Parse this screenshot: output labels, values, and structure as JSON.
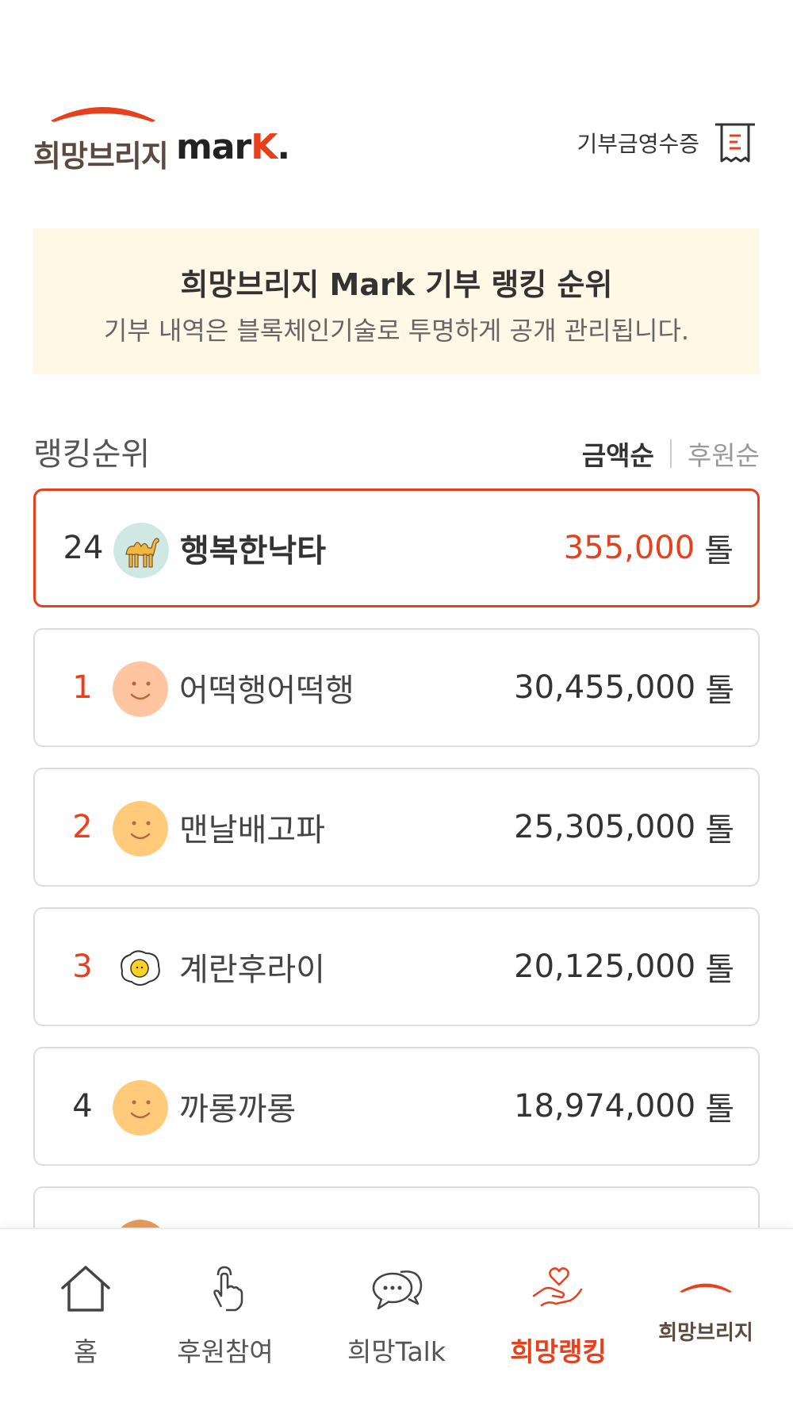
{
  "header": {
    "logo_ko": "희망브리지",
    "logo_en_main": "mar",
    "logo_en_k": "K",
    "logo_en_dot": ".",
    "receipt_label": "기부금영수증"
  },
  "banner": {
    "title": "희망브리지 Mark 기부 랭킹 순위",
    "subtitle": "기부 내역은 블록체인기술로 투명하게 공개 관리됩니다."
  },
  "ranking": {
    "section_title": "랭킹순위",
    "sort_options": [
      "금액순",
      "후원순"
    ],
    "active_sort": "금액순",
    "my_rank": {
      "rank": "24",
      "nickname": "행복한낙타",
      "amount": "355,000",
      "unit": "톨",
      "avatar": "camel-avatar"
    },
    "items": [
      {
        "rank": "1",
        "nickname": "어떡행어떡행",
        "amount": "30,455,000",
        "unit": "톨",
        "avatar": "smiley-face-avatar"
      },
      {
        "rank": "2",
        "nickname": "맨날배고파",
        "amount": "25,305,000",
        "unit": "톨",
        "avatar": "smiley-face-avatar"
      },
      {
        "rank": "3",
        "nickname": "계란후라이",
        "amount": "20,125,000",
        "unit": "톨",
        "avatar": "fried-egg-avatar"
      },
      {
        "rank": "4",
        "nickname": "까롱까롱",
        "amount": "18,974,000",
        "unit": "톨",
        "avatar": "smiley-face-avatar"
      }
    ]
  },
  "nav": {
    "items": [
      {
        "label": "홈",
        "icon": "home-icon"
      },
      {
        "label": "후원참여",
        "icon": "tap-hand-icon"
      },
      {
        "label": "희망Talk",
        "icon": "chat-bubbles-icon"
      },
      {
        "label": "희망랭킹",
        "icon": "heart-hand-icon",
        "active": true
      },
      {
        "label": "희망브리지",
        "icon": "brand-logo-icon"
      }
    ]
  },
  "colors": {
    "accent": "#e8401c",
    "banner_bg": "#fff8e6",
    "logo_brown": "#5a4a3f"
  }
}
